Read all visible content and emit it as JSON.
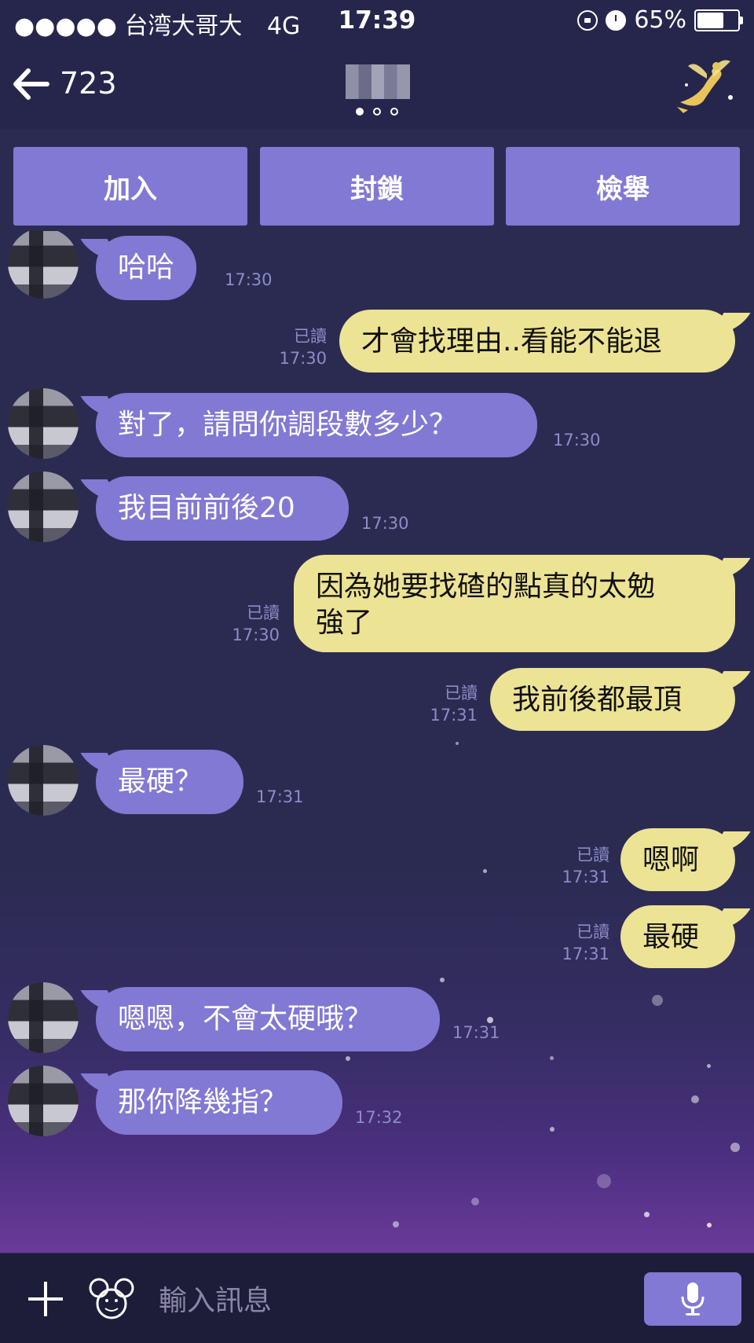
{
  "status_bar": {
    "carrier": "●●●●● 台湾大哥大",
    "network": "4G",
    "time": "17:39",
    "battery": "65%"
  },
  "nav": {
    "back_count": "723",
    "page_indicator": {
      "pages": 3,
      "current": 1
    }
  },
  "actions": {
    "add": "加入",
    "block": "封鎖",
    "report": "檢舉"
  },
  "messages": [
    {
      "side": "in",
      "text": "哈哈",
      "time": "17:30"
    },
    {
      "side": "out",
      "text": "才會找理由..看能不能退",
      "read": "已讀",
      "time": "17:30"
    },
    {
      "side": "in",
      "text": "對了，請問你調段數多少？",
      "time": "17:30"
    },
    {
      "side": "in",
      "text": "我目前前後20",
      "time": "17:30"
    },
    {
      "side": "out",
      "text": "因為她要找碴的點真的太勉\n強了",
      "read": "已讀",
      "time": "17:30"
    },
    {
      "side": "out",
      "text": "我前後都最頂",
      "read": "已讀",
      "time": "17:31"
    },
    {
      "side": "in",
      "text": "最硬？",
      "time": "17:31"
    },
    {
      "side": "out",
      "text": "嗯啊",
      "read": "已讀",
      "time": "17:31"
    },
    {
      "side": "out",
      "text": "最硬",
      "read": "已讀",
      "time": "17:31"
    },
    {
      "side": "in",
      "text": "嗯嗯，不會太硬哦？",
      "time": "17:31"
    },
    {
      "side": "in",
      "text": "那你降幾指？",
      "time": "17:32"
    }
  ],
  "input": {
    "placeholder": "輸入訊息"
  },
  "icons": {
    "back": "back-arrow-icon",
    "fairy": "tinkerbell-sticker-icon",
    "plus": "plus-icon",
    "mickey": "mickey-sticker-icon",
    "mic": "microphone-icon"
  },
  "colors": {
    "background": "#26264d",
    "incoming_bubble": "#8179d4",
    "outgoing_bubble": "#ede394",
    "meta_text": "#8c8cc8",
    "action_button": "#8179d4"
  }
}
